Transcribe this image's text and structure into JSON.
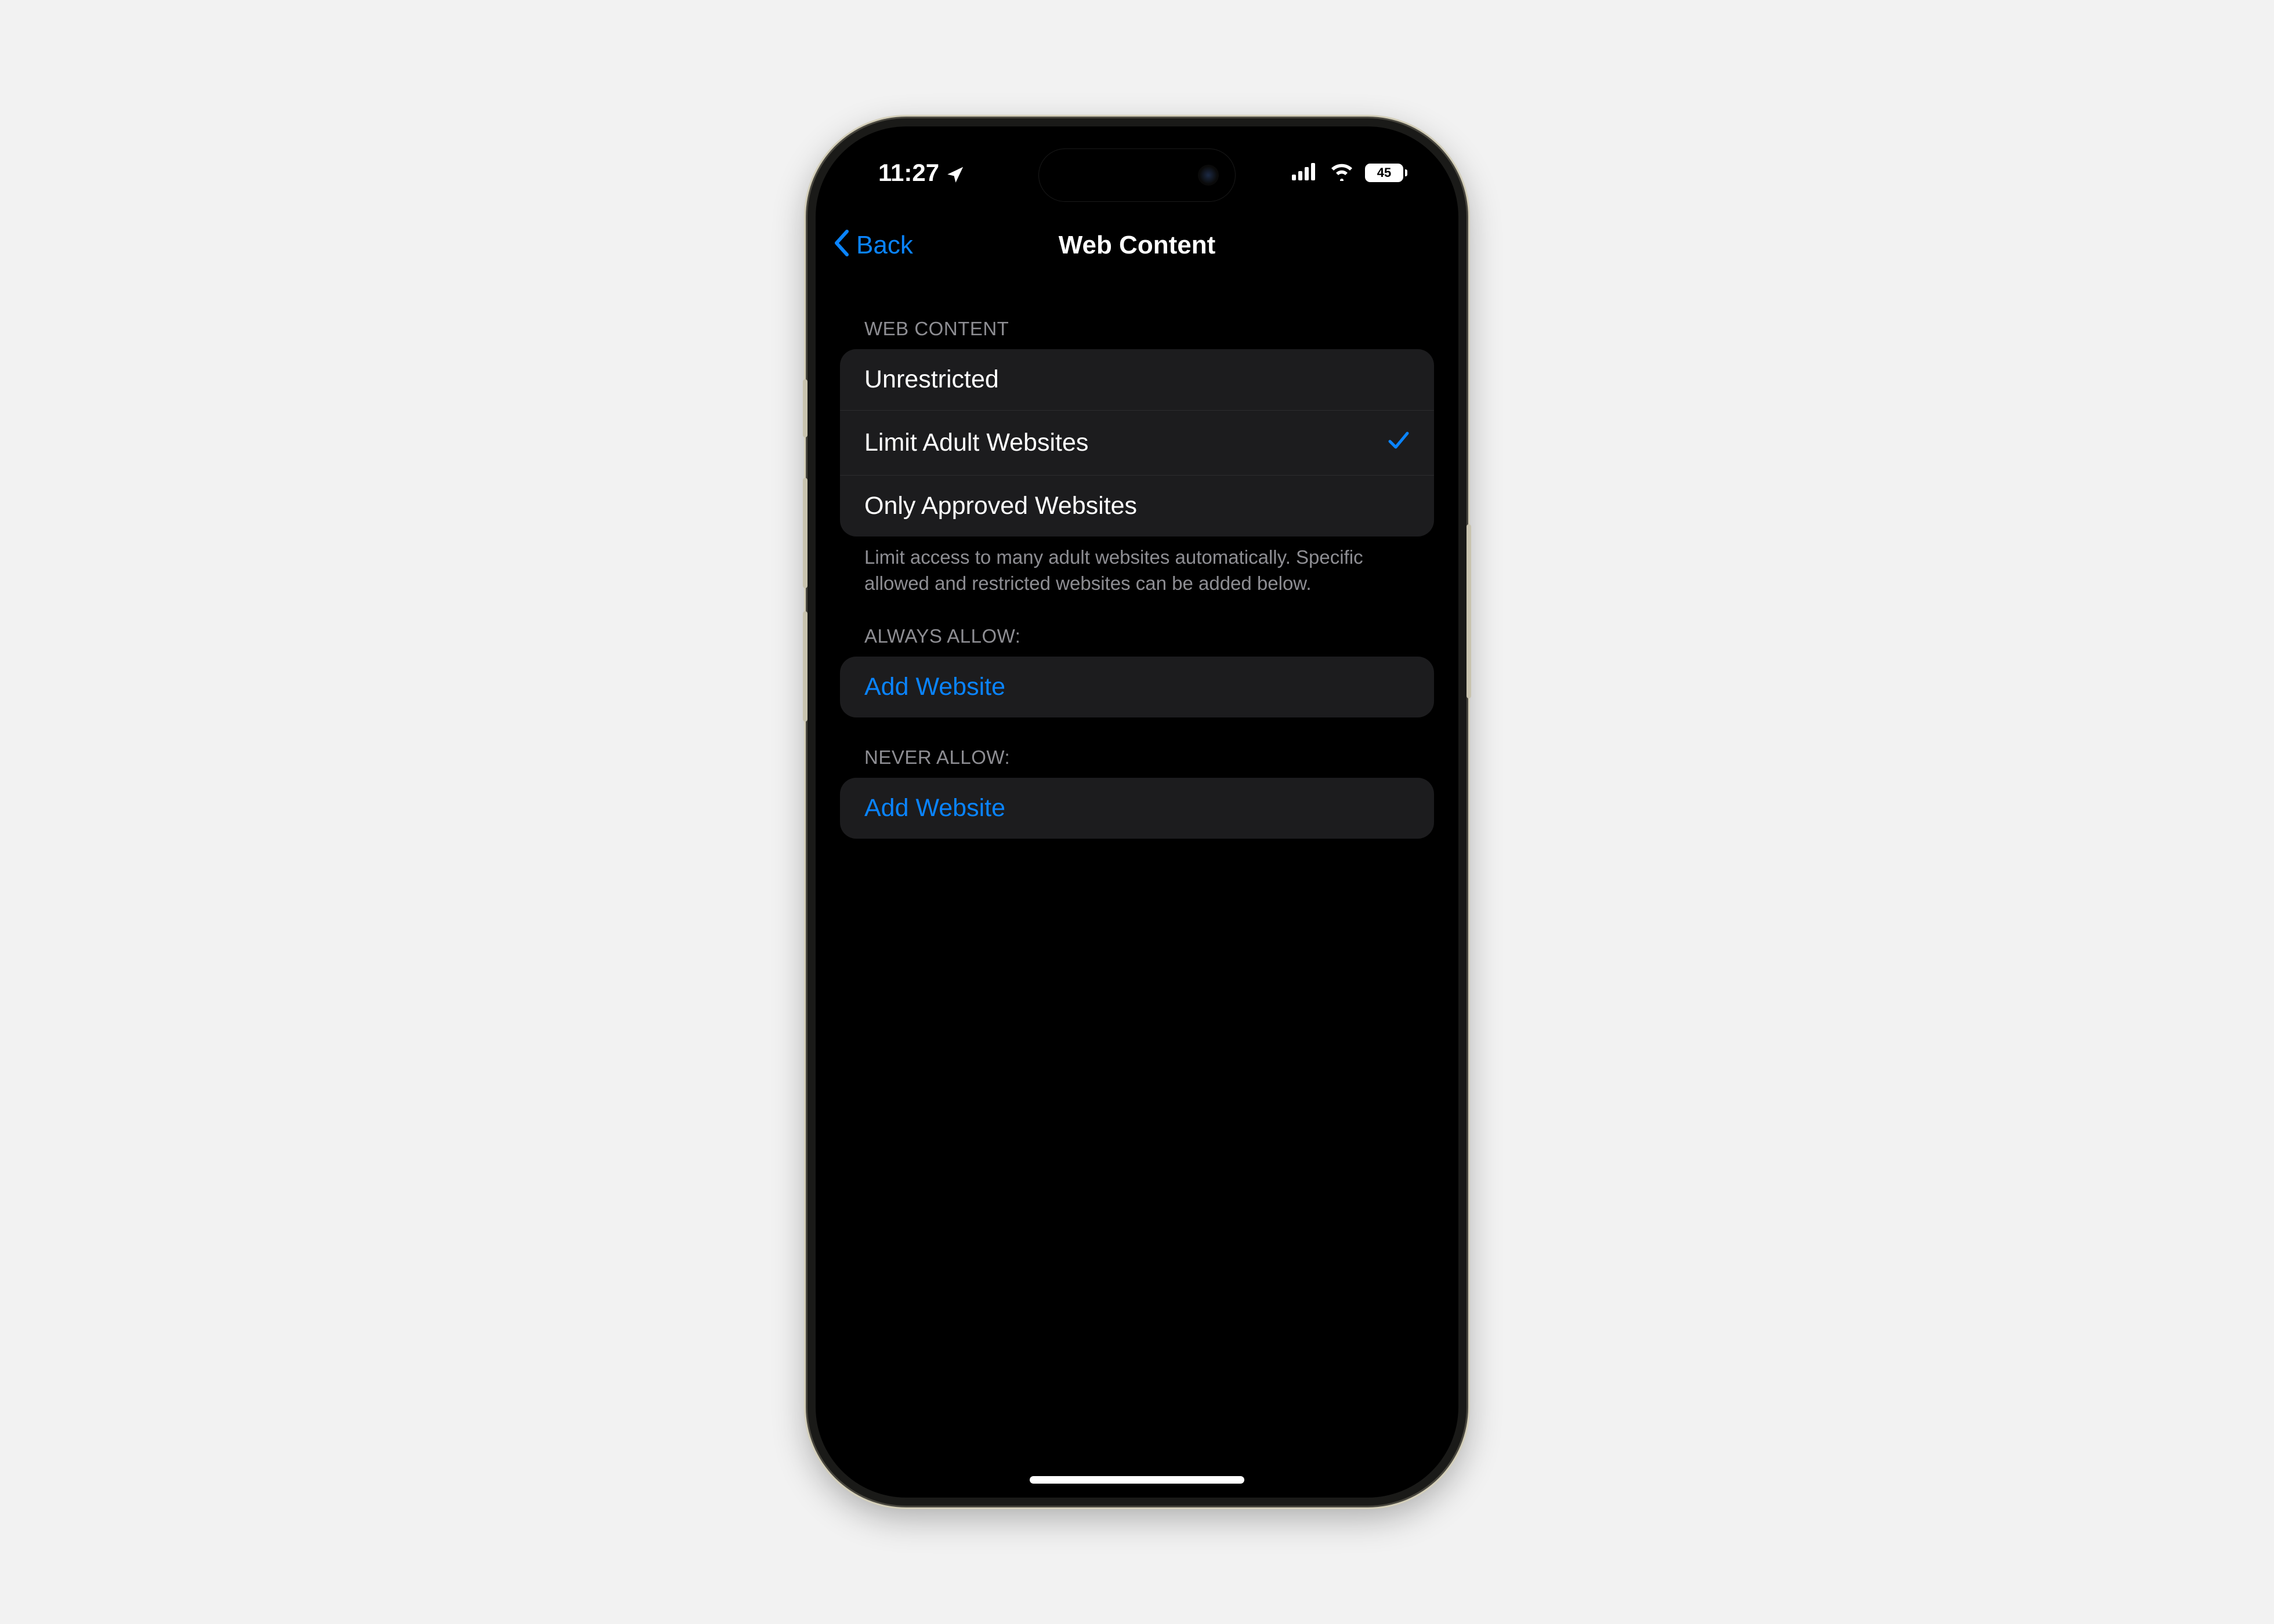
{
  "status": {
    "time": "11:27",
    "battery_level": "45"
  },
  "nav": {
    "back_label": "Back",
    "title": "Web Content"
  },
  "sections": {
    "web_content": {
      "header": "WEB CONTENT",
      "options": [
        {
          "label": "Unrestricted",
          "selected": false
        },
        {
          "label": "Limit Adult Websites",
          "selected": true
        },
        {
          "label": "Only Approved Websites",
          "selected": false
        }
      ],
      "footer": "Limit access to many adult websites automatically. Specific allowed and restricted websites can be added below."
    },
    "always_allow": {
      "header": "ALWAYS ALLOW:",
      "add_label": "Add Website"
    },
    "never_allow": {
      "header": "NEVER ALLOW:",
      "add_label": "Add Website"
    }
  }
}
